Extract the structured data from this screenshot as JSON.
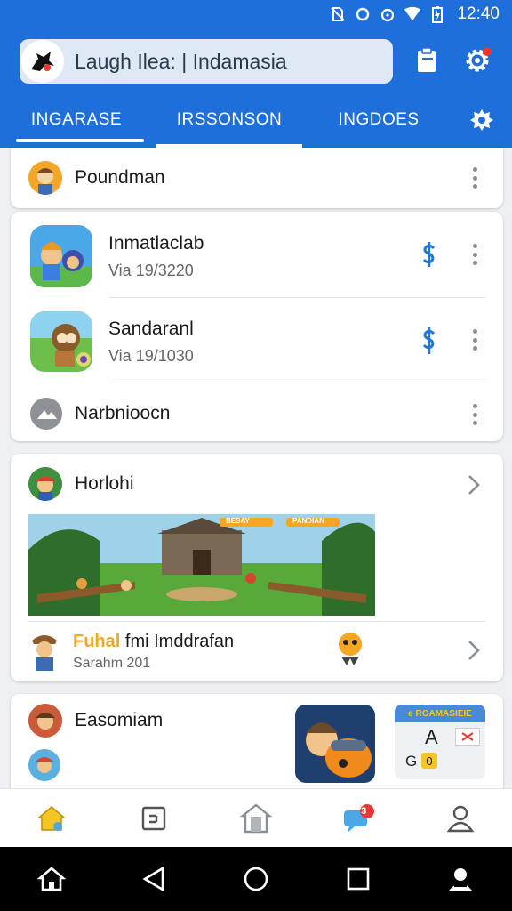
{
  "status_bar": {
    "time": "12:40"
  },
  "search": {
    "text": "Laugh Ilea: | Indamasia"
  },
  "tabs": [
    {
      "label": "INGARASE"
    },
    {
      "label": "IRSSONSON"
    },
    {
      "label": "INGDOES"
    }
  ],
  "header_row": {
    "title": "Poundman"
  },
  "games": [
    {
      "title": "Inmatlaclab",
      "subtitle": "Via 19/3220"
    },
    {
      "title": "Sandaranl",
      "subtitle": "Via 19/1030"
    }
  ],
  "misc_row": {
    "title": "Narbnioocn"
  },
  "featured": {
    "title": "Horlohi",
    "banner_label_1": "BESAY",
    "banner_label_2": "PANDIAN",
    "promo_title_highlight": "Fuhal",
    "promo_title": "fmi Imddrafan",
    "promo_subtitle": "Sarahm 201"
  },
  "bottom_card": {
    "title": "Easomiam",
    "ad_header": "e ROAMASIEIE",
    "ad_letter": "A",
    "ad_small": "G",
    "ad_coin": "0"
  },
  "bottom_nav": {
    "badge": "3"
  },
  "colors": {
    "primary": "#1e6fd9",
    "accent": "#1e78d6",
    "badge": "#e53935"
  }
}
